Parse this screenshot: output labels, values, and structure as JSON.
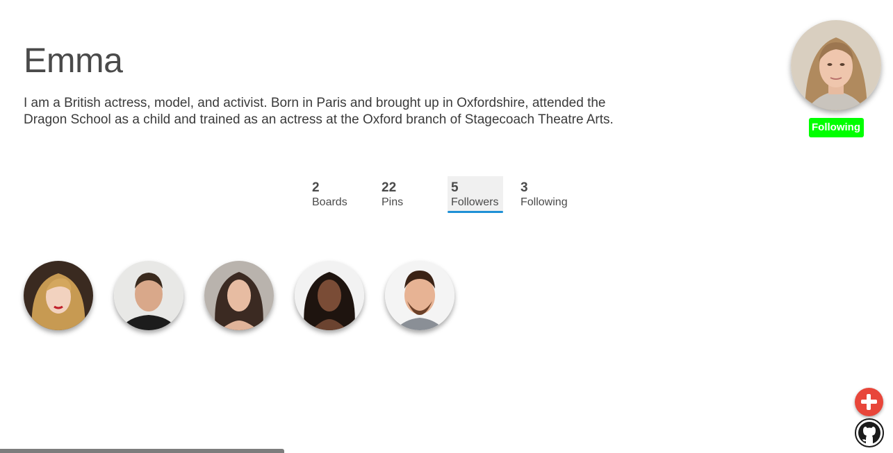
{
  "profile": {
    "name": "Emma",
    "bio": "I am a British actress, model, and activist. Born in Paris and brought up in Oxfordshire, attended the Dragon School as a child and trained as an actress at the Oxford branch of Stagecoach Theatre Arts.",
    "follow_status": "Following",
    "badge_color": "#00ff00"
  },
  "stats": [
    {
      "count": "2",
      "label": "Boards",
      "active": false
    },
    {
      "count": "22",
      "label": "Pins",
      "active": false
    },
    {
      "count": "5",
      "label": "Followers",
      "active": true
    },
    {
      "count": "3",
      "label": "Following",
      "active": false
    }
  ],
  "accent_color": "#1e90d6",
  "followers": [
    {
      "icon": "follower-avatar-1"
    },
    {
      "icon": "follower-avatar-2"
    },
    {
      "icon": "follower-avatar-3"
    },
    {
      "icon": "follower-avatar-4"
    },
    {
      "icon": "follower-avatar-5"
    }
  ],
  "actions": {
    "add_icon": "plus-icon",
    "add_color": "#e8463a",
    "github_icon": "github-icon"
  }
}
